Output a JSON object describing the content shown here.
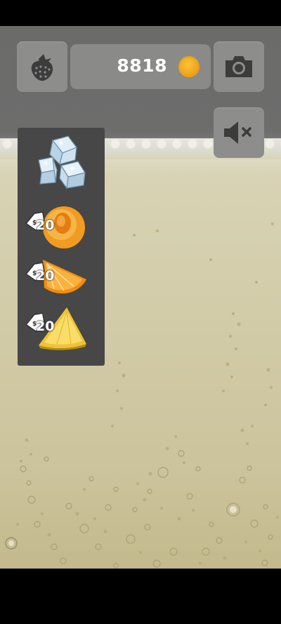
{
  "header": {
    "coins": "8818",
    "coin_icon": "coin-icon",
    "strawberry_icon": "strawberry-icon",
    "camera_icon": "camera-icon",
    "mute_icon": "speaker-muted-icon"
  },
  "ingredients": [
    {
      "name": "ice-cubes",
      "icon": "ice-cubes-icon",
      "price": ""
    },
    {
      "name": "apricot",
      "icon": "apricot-icon",
      "price": "20"
    },
    {
      "name": "orange-slice",
      "icon": "orange-slice-icon",
      "price": "20"
    },
    {
      "name": "pineapple-slice",
      "icon": "pineapple-slice-icon",
      "price": "20"
    }
  ],
  "colors": {
    "drink": "#d2cca9",
    "panel": "#474747",
    "button": "#8d8d8c",
    "coin": "#f1a81b"
  }
}
